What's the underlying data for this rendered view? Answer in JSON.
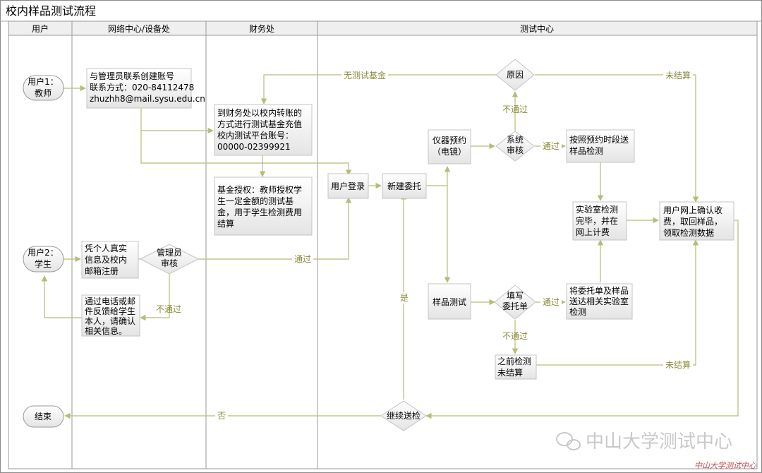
{
  "title": "校内样品测试流程",
  "lanes": [
    "用户",
    "网络中心/设备处",
    "财务处",
    "测试中心"
  ],
  "nodes": {
    "user1": [
      "用户1：",
      "教师"
    ],
    "user2": [
      "用户2：",
      "学生"
    ],
    "end": [
      "结束"
    ],
    "create_account": [
      "与管理员联系创建账号",
      "联系方式：020-84112478",
      "zhuzhh8@mail.sysu.edu.cn"
    ],
    "real_info": [
      "凭个人真实",
      "信息及校内",
      "邮箱注册"
    ],
    "admin_review": [
      "管理员",
      "审核"
    ],
    "feedback": [
      "通过电话或邮",
      "件反馈给学生",
      "本人，请确认",
      "相关信息。"
    ],
    "finance_transfer": [
      "到财务处以校内转账的",
      "方式进行测试基金充值",
      "校内测试平台账号：",
      "00000-02399921"
    ],
    "fund_auth": [
      "基金授权：教师授权学",
      "生一定金额的测试基",
      "金，用于学生检测费用",
      "结算"
    ],
    "login": [
      "用户登录"
    ],
    "new_commission": [
      "新建委托"
    ],
    "reason": [
      "原因"
    ],
    "instrument": [
      "仪器预约",
      "（电镜）"
    ],
    "system_review": [
      "系统",
      "审核"
    ],
    "send_by_time": [
      "按照预约时段送",
      "样品检测"
    ],
    "lab_done": [
      "实验室检测",
      "完毕，并在",
      "网上计费"
    ],
    "confirm_fee": [
      "用户网上确认收",
      "费，取回样品，",
      "领取检测数据"
    ],
    "sample_test": [
      "样品测试"
    ],
    "fill_form": [
      "填写",
      "委托单"
    ],
    "send_to_lab": [
      "将委托单及样品",
      "送达相关实验室",
      "检测"
    ],
    "prev_unsettled": [
      "之前检测",
      "未结算"
    ],
    "continue_test": [
      "继续送检"
    ]
  },
  "edge_labels": {
    "no_fund": "无测试基金",
    "unsettled_top": "未结算",
    "fail_reason": "不通过",
    "pass_system": "通过",
    "pass_admin": "通过",
    "fail_admin": "不通过",
    "pass_fill": "通过",
    "fail_fill": "不通过",
    "unsettled_bottom": "未结算",
    "yes": "是",
    "no": "否"
  },
  "watermark": "中山大学测试中心",
  "watermark_small": "中山大学测试中心",
  "colors": {
    "line": "#b8bc74",
    "label": "#8a8a3a",
    "watermark": "#c9c9c9"
  }
}
